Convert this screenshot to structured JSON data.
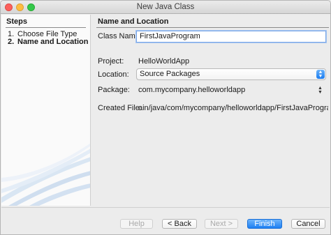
{
  "window": {
    "title": "New Java Class"
  },
  "steps": {
    "heading": "Steps",
    "items": [
      {
        "num": "1.",
        "label": "Choose File Type"
      },
      {
        "num": "2.",
        "label": "Name and Location"
      }
    ]
  },
  "form": {
    "heading": "Name and Location",
    "class_name": {
      "label": "Class Name:",
      "value": "FirstJavaProgram"
    },
    "project": {
      "label": "Project:",
      "value": "HelloWorldApp"
    },
    "location": {
      "label": "Location:",
      "value": "Source Packages"
    },
    "package": {
      "label": "Package:",
      "value": "com.mycompany.helloworldapp"
    },
    "created_file": {
      "label": "Created File:",
      "value": "ain/java/com/mycompany/helloworldapp/FirstJavaProgram.java"
    }
  },
  "buttons": {
    "help": "Help",
    "back": "< Back",
    "next": "Next >",
    "finish": "Finish",
    "cancel": "Cancel"
  },
  "colors": {
    "accent": "#1d7ff2",
    "focus_ring": "#7aa7e8"
  }
}
